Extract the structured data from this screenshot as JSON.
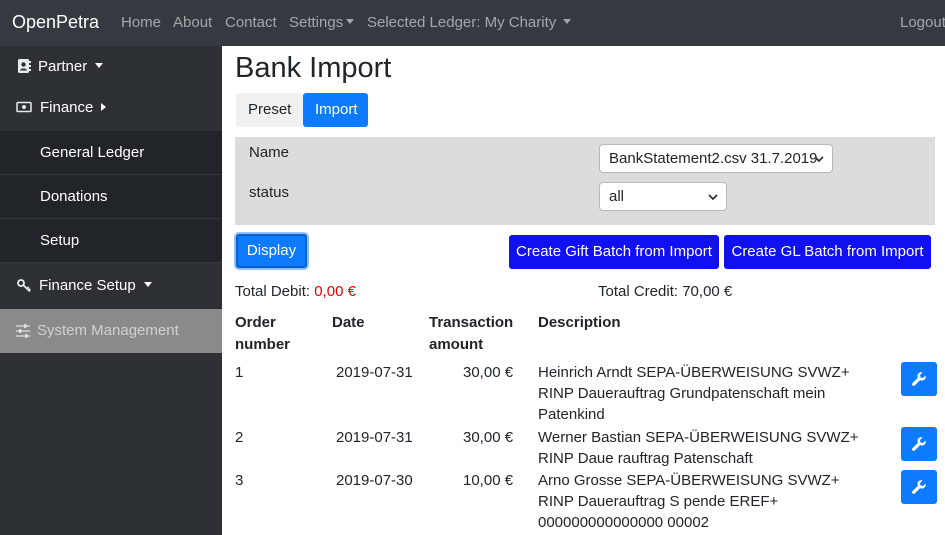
{
  "navbar": {
    "brand": "OpenPetra",
    "home": "Home",
    "about": "About",
    "contact": "Contact",
    "settings": "Settings",
    "ledger": "Selected Ledger: My Charity",
    "logout": "Logout"
  },
  "sidebar": {
    "partner": "Partner",
    "finance": "Finance",
    "general_ledger": "General Ledger",
    "donations": "Donations",
    "setup": "Setup",
    "finance_setup": "Finance Setup",
    "system_management": "System Management"
  },
  "page": {
    "title": "Bank Import",
    "tabs": [
      "Preset",
      "Import"
    ]
  },
  "filter": {
    "name_label": "Name",
    "name_value": "BankStatement2.csv 31.7.2019",
    "status_label": "status",
    "status_value": "all"
  },
  "actions": {
    "display": "Display",
    "gift_batch": "Create Gift Batch from Import",
    "gl_batch": "Create GL Batch from Import"
  },
  "totals": {
    "debit_label": "Total Debit:",
    "debit_value": "0,00 €",
    "credit_label": "Total Credit:",
    "credit_value": "70,00 €"
  },
  "table": {
    "headers": {
      "order_1": "Order",
      "order_2": "number",
      "date": "Date",
      "amount_1": "Transaction",
      "amount_2": "amount",
      "description": "Description"
    },
    "rows": [
      {
        "order": "1",
        "date": "2019-07-31",
        "amount": "30,00 €",
        "description": "Heinrich Arndt SEPA-ÜBERWEISUNG SVWZ+ RINP Dauerauftrag Grundpatenschaft mein Patenkind"
      },
      {
        "order": "2",
        "date": "2019-07-31",
        "amount": "30,00 €",
        "description": "Werner Bastian SEPA-ÜBERWEISUNG SVWZ+ RINP Daue rauftrag Patenschaft"
      },
      {
        "order": "3",
        "date": "2019-07-30",
        "amount": "10,00 €",
        "description": "Arno Grosse SEPA-ÜBERWEISUNG SVWZ+ RINP Dauerauftrag S pende EREF+ 000000000000000 00002"
      }
    ]
  },
  "colors": {
    "navbar": "#343a40",
    "primary": "#0d7bff",
    "batch_button": "#1010f0",
    "debit": "#e60000"
  }
}
